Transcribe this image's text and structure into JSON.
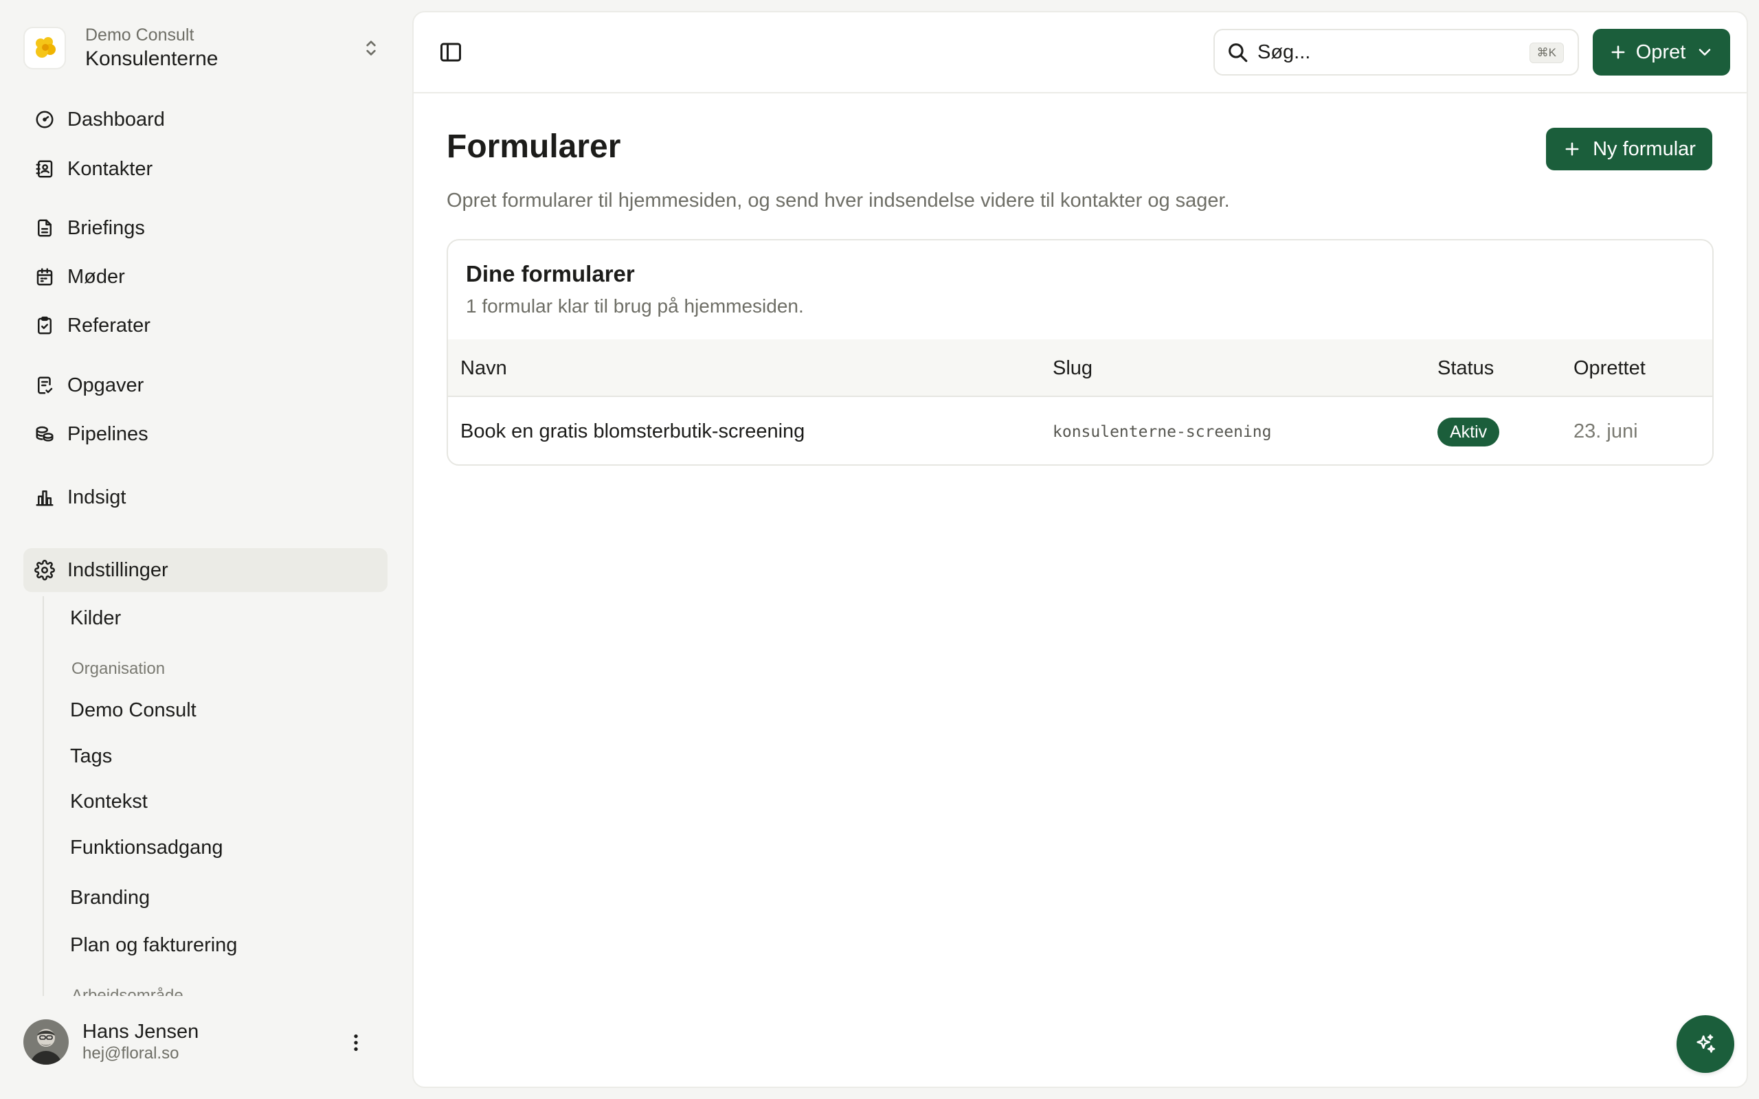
{
  "org": {
    "sub": "Demo Consult",
    "name": "Konsulenterne"
  },
  "nav": {
    "dashboard": "Dashboard",
    "contacts": "Kontakter",
    "briefings": "Briefings",
    "meetings": "Møder",
    "minutes": "Referater",
    "tasks": "Opgaver",
    "pipelines": "Pipelines",
    "insight": "Indsigt",
    "settings": "Indstillinger"
  },
  "subnav": {
    "sources": "Kilder",
    "org_heading": "Organisation",
    "demo_consult": "Demo Consult",
    "tags": "Tags",
    "context": "Kontekst",
    "access": "Funktionsadgang",
    "branding": "Branding",
    "billing": "Plan og fakturering",
    "workspace_heading": "Arbejdsområde"
  },
  "user": {
    "name": "Hans Jensen",
    "email": "hej@floral.so"
  },
  "topbar": {
    "search_placeholder": "Søg...",
    "search_shortcut": "⌘K",
    "create_label": "Opret"
  },
  "page": {
    "title": "Formularer",
    "description": "Opret formularer til hjemmesiden, og send hver indsendelse videre til kontakter og sager.",
    "new_button": "Ny formular"
  },
  "card": {
    "title": "Dine formularer",
    "subtitle": "1 formular klar til brug på hjemmesiden.",
    "columns": [
      "Navn",
      "Slug",
      "Status",
      "Oprettet"
    ],
    "rows": [
      {
        "name": "Book en gratis blomsterbutik-screening",
        "slug": "konsulenterne-screening",
        "status": "Aktiv",
        "created": "23. juni"
      }
    ]
  },
  "colors": {
    "brand": "#1b5e3b",
    "background": "#f5f5f3",
    "logo": "#f5c518"
  }
}
